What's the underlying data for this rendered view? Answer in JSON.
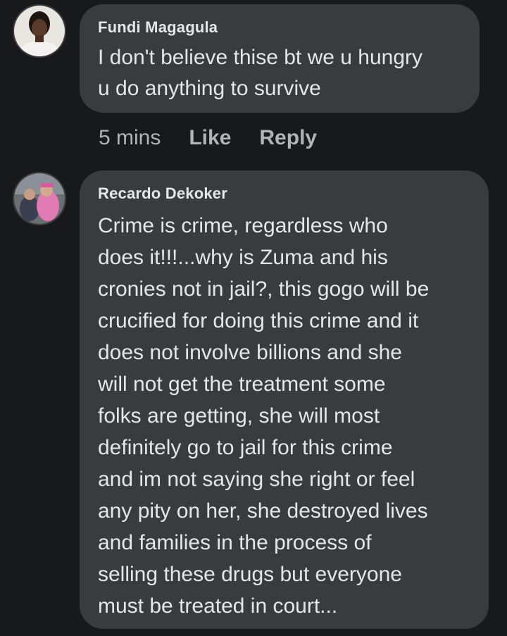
{
  "comments": [
    {
      "author": "Fundi Magagula",
      "text": "I don't believe thise bt we u hungry\nu do anything to survive",
      "time": "5 mins",
      "like_label": "Like",
      "reply_label": "Reply"
    },
    {
      "author": "Recardo Dekoker",
      "text": "Crime is crime, regardless who\ndoes it!!!...why is Zuma and his\ncronies not in jail?, this gogo will be\ncrucified for doing this crime and it\ndoes not involve billions and she\nwill not get the treatment some\nfolks are getting, she will most\ndefinitely go to jail for this crime\nand im not saying she right or feel\nany pity on her, she destroyed lives\nand families in the process of\nselling these drugs but everyone\nmust be treated in court..."
    }
  ],
  "colors": {
    "background": "#18191a",
    "bubble": "#3a3b3c",
    "primary_text": "#e4e6eb",
    "secondary_text": "#b0b3b8"
  }
}
